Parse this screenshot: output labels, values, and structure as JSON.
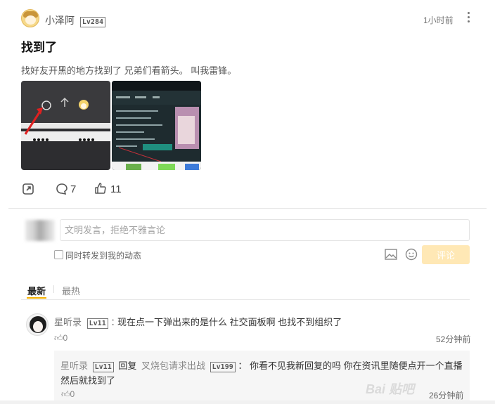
{
  "post": {
    "username": "小泽阿",
    "level": "Lv284",
    "time": "1小时前",
    "title": "找到了",
    "body": "找好友开黑的地方找到了 兄弟们看箭头。 叫我雷锋。",
    "comment_count": "7",
    "like_count": "11"
  },
  "editor": {
    "placeholder": "文明发言，拒绝不雅言论",
    "repost_label": "同时转发到我的动态",
    "submit_label": "评论"
  },
  "tabs": [
    {
      "label": "最新"
    },
    {
      "label": "最热"
    }
  ],
  "comments": [
    {
      "user": "星听录",
      "level": "Lv11",
      "text": "现在点一下弹出来的是什么 社交面板啊 也找不到组织了",
      "likes": "0",
      "time": "52分钟前",
      "reply": {
        "user": "星听录",
        "level": "Lv11",
        "reply_word": "回复",
        "target": "叉烧包请求出战",
        "target_level": "Lv199",
        "text_line1": "你看不见我新回复的吗 你在资讯里随便点开一个直播",
        "text_line2": "然后就找到了",
        "likes": "0",
        "time": "26分钟前"
      }
    }
  ],
  "watermark": "Bai 贴吧",
  "colors": {
    "accent": "#f5b000",
    "submit_bg": "#ffe8b5",
    "arrow": "#e02020"
  }
}
